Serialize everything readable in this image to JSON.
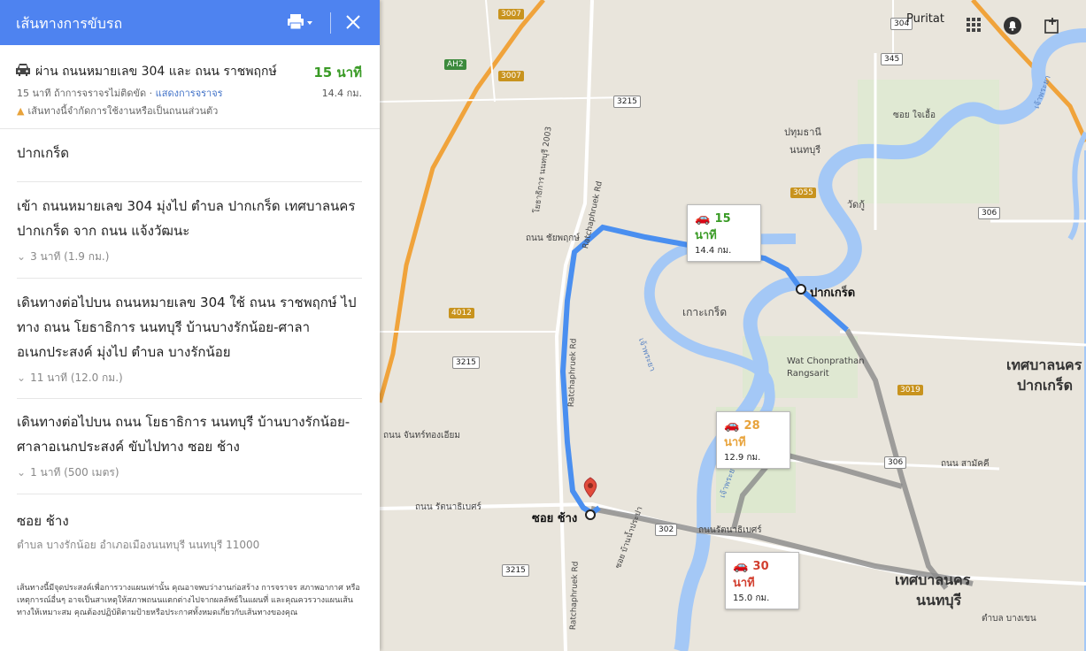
{
  "panel": {
    "title": "เส้นทางการขับรถ",
    "summary": {
      "via": "ผ่าน ถนนหมายเลข 304 และ ถนน ราชพฤกษ์",
      "time": "15 นาที",
      "traffic_text": "15 นาที ถ้าการจราจรไม่ติดขัด · ",
      "traffic_link": "แสดงการจราจร",
      "distance": "14.4 กม.",
      "warning": "เส้นทางนี้จำกัดการใช้งานหรือเป็นถนนส่วนตัว"
    },
    "start": "ปากเกร็ด",
    "steps": [
      {
        "text": "เข้า ถนนหมายเลข 304 มุ่งไป ตำบล ปากเกร็ด เทศบาลนคร ปากเกร็ด จาก ถนน แจ้งวัฒนะ",
        "meta": "3 นาที (1.9 กม.)"
      },
      {
        "text": "เดินทางต่อไปบน ถนนหมายเลข 304 ใช้ ถนน ราชพฤกษ์ ไปทาง ถนน โยธาธิการ นนทบุรี บ้านบางรักน้อย-ศาลาอเนกประสงค์ มุ่งไป ตำบล บางรักน้อย",
        "meta": "11 นาที (12.0 กม.)"
      },
      {
        "text": "เดินทางต่อไปบน ถนน โยธาธิการ นนทบุรี บ้านบางรักน้อย-ศาลาอเนกประสงค์ ขับไปทาง ซอย ช้าง",
        "meta": "1 นาที (500 เมตร)"
      }
    ],
    "destination": {
      "name": "ซอย ช้าง",
      "address": "ตำบล บางรักน้อย อำเภอเมืองนนทบุรี นนทบุรี 11000"
    },
    "disclaimer": "เส้นทางนี้มีจุดประสงค์เพื่อการวางแผนเท่านั้น คุณอาจพบว่างานก่อสร้าง การจราจร สภาพอากาศ หรือเหตุการณ์อื่นๆ อาจเป็นสาเหตุให้สภาพถนนแตกต่างไปจากผลลัพธ์ในแผนที่ และคุณควรวางแผนเส้นทางให้เหมาะสม คุณต้องปฏิบัติตามป้ายหรือประกาศทั้งหมดเกี่ยวกับเส้นทางของคุณ"
  },
  "map": {
    "user": "Puritat",
    "route_boxes": [
      {
        "time": "15 นาที",
        "distance": "14.4 กม.",
        "color": "#3a9b26"
      },
      {
        "time": "28 นาที",
        "distance": "12.9 กม.",
        "color": "#e8a33b"
      },
      {
        "time": "30 นาที",
        "distance": "15.0 กม.",
        "color": "#d23f2f"
      }
    ],
    "places": {
      "pakkret": "ปากเกร็ด",
      "soi_chang": "ซอย ช้าง",
      "koh_kret": "เกาะเกร็ด",
      "wat": "Wat Chonprathan Rangsarit",
      "tesaban_pakkret_1": "เทศบาลนคร",
      "tesaban_pakkret_2": "ปากเกร็ด",
      "tesaban_nonthaburi_1": "เทศบาลนคร",
      "tesaban_nonthaburi_2": "นนทบุรี",
      "pathum": "ปทุมธานี",
      "nonthaburi": "นนทบุรี",
      "watku": "วัดกู้",
      "jaeng": "ซอย ใจเอื้อ",
      "bangkhen": "ตำบล บางเขน",
      "chaipruek": "ถนน ชัยพฤกษ์",
      "samakkhi": "ถนน สามัคคี",
      "ratanathibet": "ถนน รัตนาธิเบศร์",
      "ratanathibet2": "ถนนรัตนาธิเบศร์",
      "chankrong": "ถนน จันทร์ทองเอียม",
      "ratchapruek": "Ratchaphruek Rd",
      "ratchapruek2": "Ratchaphruek Rd",
      "ratchapruek3": "Ratchaphruek Rd",
      "yotha": "โยธาธิการ นนทบุรี 2003",
      "soi_bannaipa": "ซอย บ้านน้ำประปา",
      "river": "เจ้าพระยา",
      "river2": "เจ้าพระยา",
      "river3": "เจ้าพระยา"
    },
    "shields": [
      "3007",
      "3007",
      "AH2",
      "3215",
      "4012",
      "3215",
      "3215",
      "302",
      "304",
      "345",
      "306",
      "3055",
      "3019",
      "306"
    ]
  }
}
